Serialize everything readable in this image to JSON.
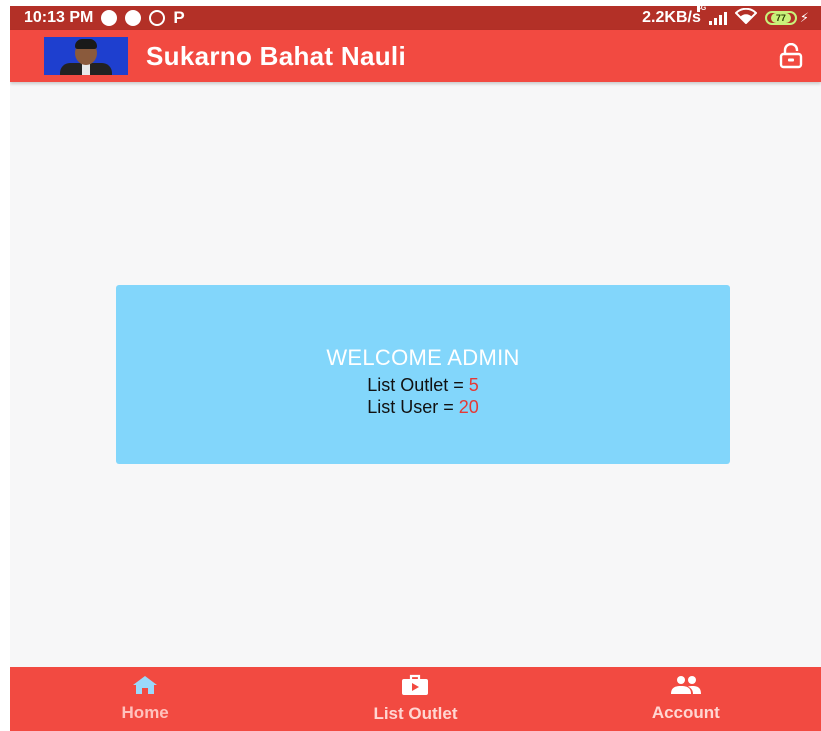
{
  "status_bar": {
    "time": "10:13 PM",
    "notification_icons": [
      "ppob-icon",
      "messenger-icon",
      "whatsapp-icon",
      "p-icon"
    ],
    "p_glyph": "P",
    "network_speed": "2.2KB/s",
    "signal_label": "4G",
    "battery_level": "77",
    "charging_glyph": "⚡"
  },
  "app_bar": {
    "title": "Sukarno Bahat Nauli",
    "action_icon": "lock-open-icon"
  },
  "welcome_card": {
    "title": "WELCOME ADMIN",
    "outlet_label": "List Outlet = ",
    "outlet_count": "5",
    "user_label": "List User = ",
    "user_count": "20"
  },
  "bottom_nav": {
    "items": [
      {
        "label": "Home",
        "icon": "home-icon",
        "active": true
      },
      {
        "label": "List Outlet",
        "icon": "briefcase-play-icon",
        "active": false
      },
      {
        "label": "Account",
        "icon": "people-icon",
        "active": false
      }
    ]
  },
  "colors": {
    "status_bar": "#b33027",
    "app_bar": "#f24a41",
    "card": "#82d6fb",
    "count_value": "#e53935",
    "home_icon": "#9ad9fb"
  }
}
